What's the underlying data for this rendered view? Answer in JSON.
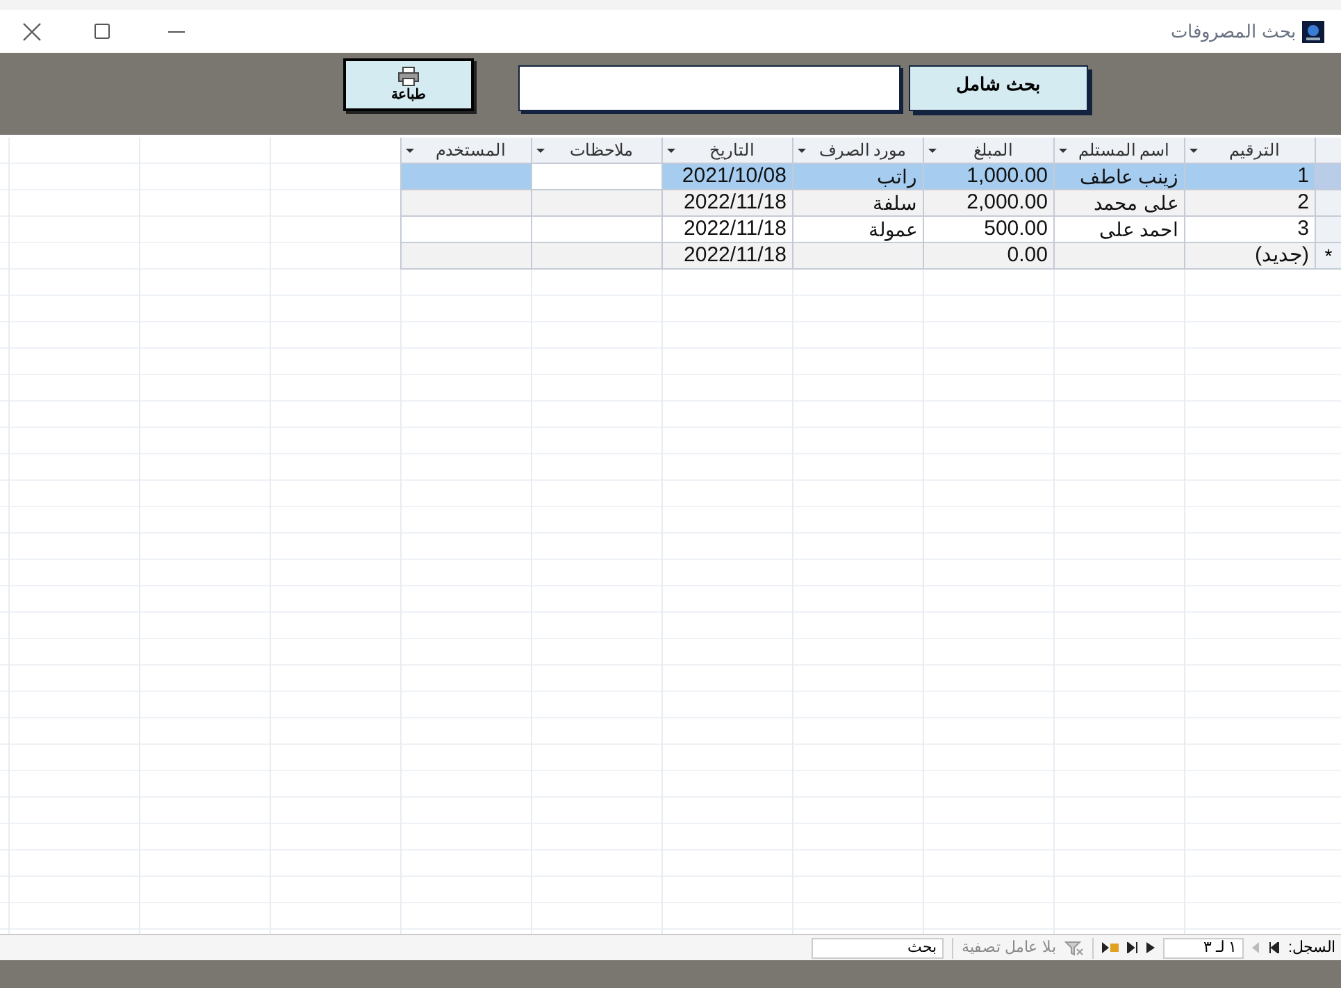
{
  "window": {
    "title": "بحث المصروفات"
  },
  "toolbar": {
    "search_button": "بحث شامل",
    "print_button": "طباعة"
  },
  "table": {
    "columns": [
      "الترقيم",
      "اسم المستلم",
      "المبلغ",
      "مورد الصرف",
      "التاريخ",
      "ملاحظات",
      "المستخدم"
    ],
    "rows": [
      {
        "kind": "record",
        "selected": true,
        "cells": [
          "1",
          "زينب عاطف",
          "1,000.00",
          "راتب",
          "2021/10/08",
          "",
          ""
        ]
      },
      {
        "kind": "record",
        "selected": false,
        "cells": [
          "2",
          "على محمد",
          "2,000.00",
          "سلفة",
          "2022/11/18",
          "",
          ""
        ]
      },
      {
        "kind": "record",
        "selected": false,
        "cells": [
          "3",
          "احمد على",
          "500.00",
          "عمولة",
          "2022/11/18",
          "",
          ""
        ]
      },
      {
        "kind": "new",
        "selected": false,
        "marker": "*",
        "cells": [
          "(جديد)",
          "",
          "0.00",
          "",
          "2022/11/18",
          "",
          ""
        ]
      }
    ]
  },
  "record_navigator": {
    "label": "السجل:",
    "position": "١ لـ ٣",
    "filter": "بلا عامل تصفية",
    "search": "بحث"
  }
}
